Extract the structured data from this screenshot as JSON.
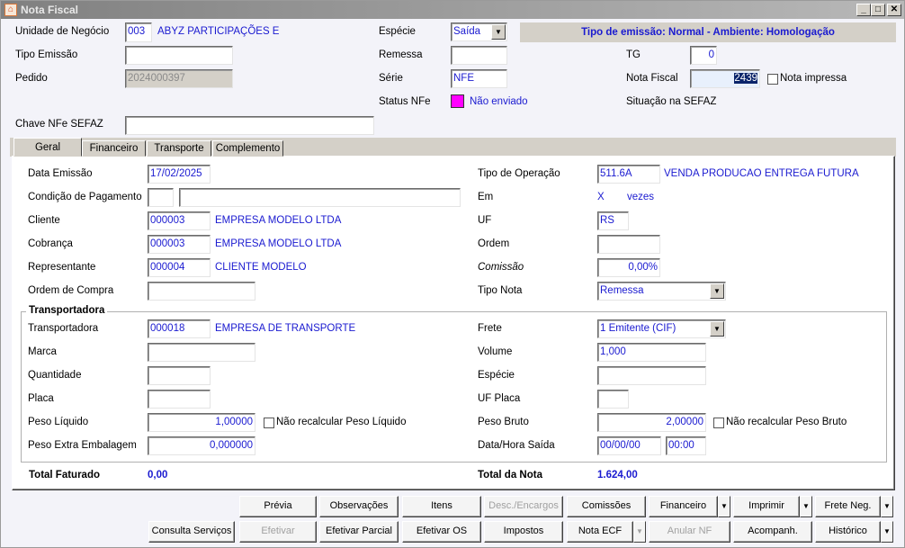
{
  "window": {
    "title": "Nota Fiscal",
    "icon": "app-logo-icon",
    "controls": [
      "minimize",
      "maximize",
      "close"
    ]
  },
  "header": {
    "unidade": {
      "label": "Unidade de Negócio",
      "code": "003",
      "name": "ABYZ PARTICIPAÇÕES E"
    },
    "tipo_emissao": {
      "label": "Tipo Emissão",
      "value": ""
    },
    "pedido": {
      "label": "Pedido",
      "value": "2024000397"
    },
    "chave": {
      "label": "Chave NFe SEFAZ",
      "value": ""
    },
    "especie": {
      "label": "Espécie",
      "value": "Saída"
    },
    "remessa": {
      "label": "Remessa",
      "value": ""
    },
    "serie": {
      "label": "Série",
      "value": "NFE"
    },
    "status": {
      "label": "Status NFe",
      "value": "Não enviado",
      "color": "#ff00ff"
    },
    "banner": "Tipo de emissão: Normal - Ambiente: Homologação",
    "tg": {
      "label": "TG",
      "value": "0"
    },
    "nota_fiscal": {
      "label": "Nota Fiscal",
      "value": "2439"
    },
    "nota_impressa": {
      "label": "Nota impressa",
      "checked": false
    },
    "situacao": {
      "label": "Situação na SEFAZ",
      "value": ""
    }
  },
  "tabs": [
    {
      "label": "Geral",
      "selected": true
    },
    {
      "label": "Financeiro"
    },
    {
      "label": "Transporte"
    },
    {
      "label": "Complemento"
    }
  ],
  "geral": {
    "data_emissao": {
      "label": "Data Emissão",
      "value": "17/02/2025"
    },
    "condicao": {
      "label": "Condição de Pagamento",
      "code": "",
      "desc": ""
    },
    "cliente": {
      "label": "Cliente",
      "code": "000003",
      "name": "EMPRESA MODELO LTDA"
    },
    "cobranca": {
      "label": "Cobrança",
      "code": "000003",
      "name": "EMPRESA MODELO LTDA"
    },
    "representante": {
      "label": "Representante",
      "code": "000004",
      "name": "CLIENTE MODELO"
    },
    "ordem_compra": {
      "label": "Ordem de Compra",
      "value": ""
    },
    "tipo_operacao": {
      "label": "Tipo de Operação",
      "code": "511.6A",
      "desc": "VENDA PRODUCAO  ENTREGA FUTURA"
    },
    "em": {
      "label": "Em",
      "x": "X",
      "vezes": "vezes"
    },
    "uf": {
      "label": "UF",
      "value": "RS"
    },
    "ordem": {
      "label": "Ordem",
      "value": ""
    },
    "comissao": {
      "label": "Comissão",
      "value": "0,00%"
    },
    "tipo_nota": {
      "label": "Tipo Nota",
      "value": "Remessa"
    }
  },
  "transportadora": {
    "legend": "Transportadora",
    "transportadora": {
      "label": "Transportadora",
      "code": "000018",
      "name": "EMPRESA DE TRANSPORTE"
    },
    "frete": {
      "label": "Frete",
      "value": "1 Emitente (CIF)"
    },
    "marca": {
      "label": "Marca",
      "value": ""
    },
    "volume": {
      "label": "Volume",
      "value": "1,000"
    },
    "quantidade": {
      "label": "Quantidade",
      "value": ""
    },
    "especie": {
      "label": "Espécie",
      "value": ""
    },
    "placa": {
      "label": "Placa",
      "value": ""
    },
    "uf_placa": {
      "label": "UF Placa",
      "value": ""
    },
    "peso_liquido": {
      "label": "Peso Líquido",
      "value": "1,00000",
      "check_label": "Não recalcular Peso Líquido"
    },
    "peso_bruto": {
      "label": "Peso Bruto",
      "value": "2,00000",
      "check_label": "Não recalcular Peso Bruto"
    },
    "peso_extra": {
      "label": "Peso Extra Embalagem",
      "value": "0,000000"
    },
    "data_hora_saida": {
      "label": "Data/Hora Saída",
      "date": "00/00/00",
      "time": "00:00"
    }
  },
  "totals": {
    "faturado": {
      "label": "Total Faturado",
      "value": "0,00"
    },
    "nota": {
      "label": "Total da Nota",
      "value": "1.624,00"
    }
  },
  "buttons": {
    "previa": "Prévia",
    "observacoes": "Observações",
    "itens": "Itens",
    "desc_encargos": "Desc./Encargos",
    "comissoes": "Comissões",
    "financeiro": "Financeiro",
    "imprimir": "Imprimir",
    "frete_neg": "Frete Neg.",
    "consulta_servicos": "Consulta Serviços",
    "efetivar": "Efetivar",
    "efetivar_parcial": "Efetivar Parcial",
    "efetivar_os": "Efetivar OS",
    "impostos": "Impostos",
    "nota_ecf": "Nota ECF",
    "anular_nf": "Anular NF",
    "acompanh": "Acompanh.",
    "historico": "Histórico"
  }
}
